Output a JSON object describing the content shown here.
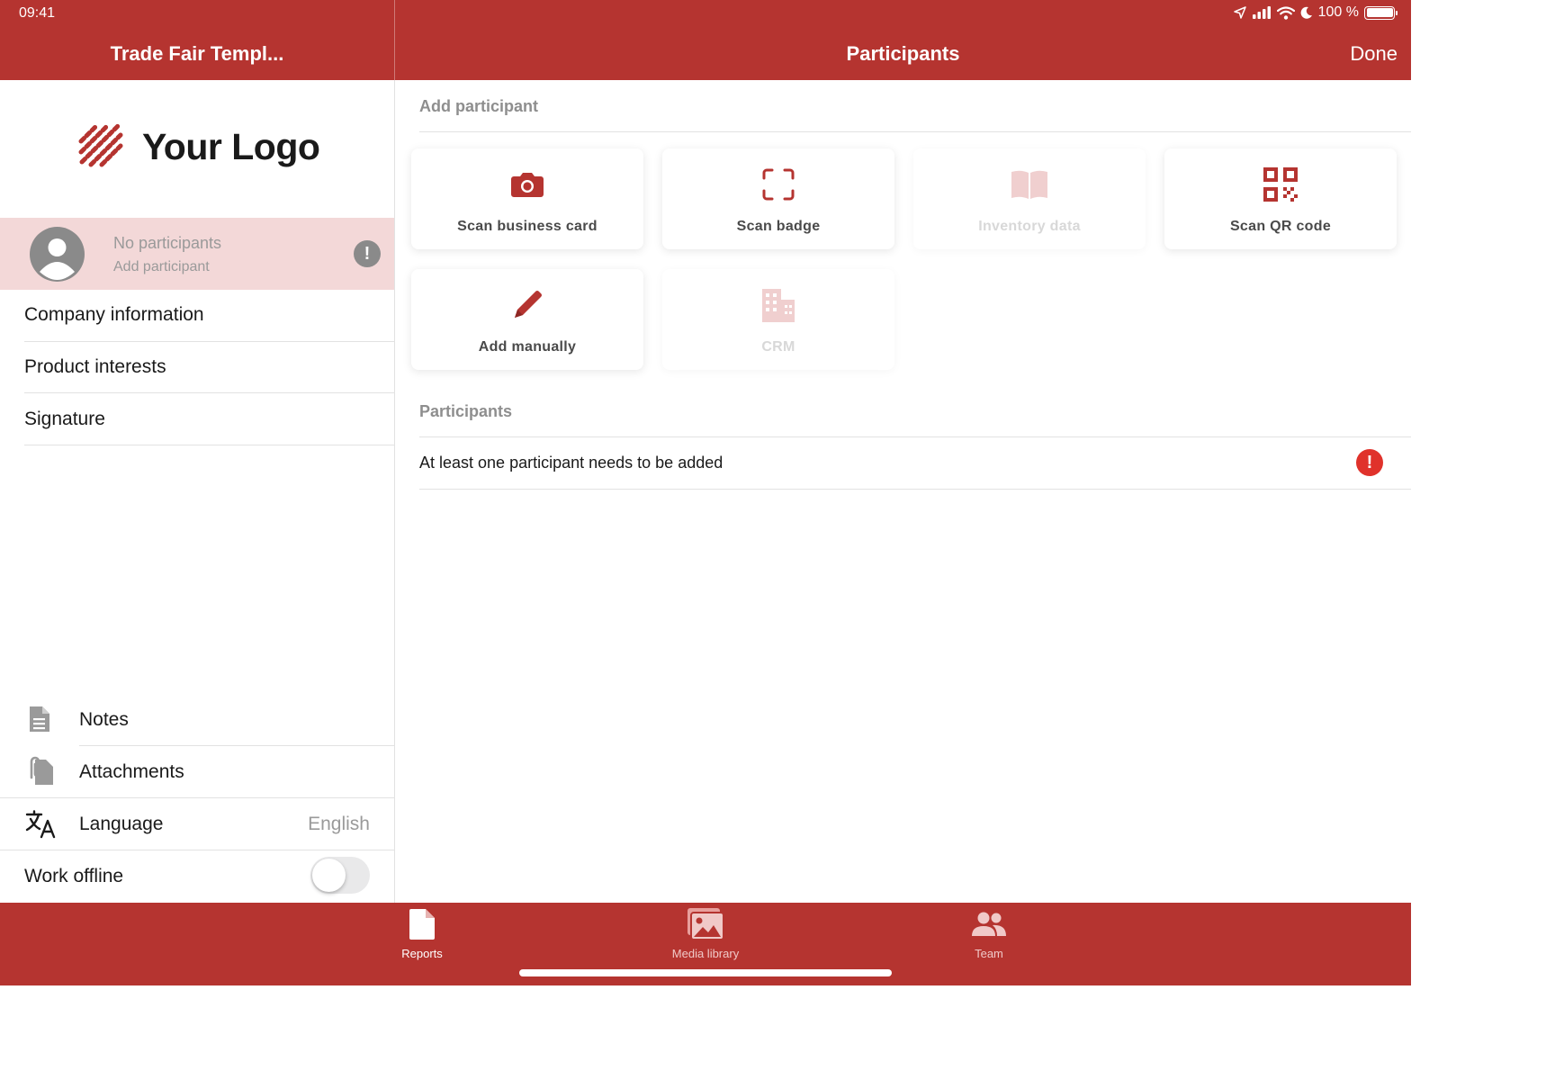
{
  "status_bar": {
    "time": "09:41",
    "battery": "100 %"
  },
  "header": {
    "left_title": "Trade Fair Templ...",
    "title": "Participants",
    "done_label": "Done"
  },
  "sidebar": {
    "logo_text": "Your Logo",
    "participant": {
      "title": "No participants",
      "subtitle": "Add participant",
      "warning_glyph": "!"
    },
    "items": [
      {
        "label": "Company information"
      },
      {
        "label": "Product interests"
      },
      {
        "label": "Signature"
      }
    ],
    "bottom_items": [
      {
        "label": "Notes",
        "icon": "document-icon"
      },
      {
        "label": "Attachments",
        "icon": "paperclip-icon"
      },
      {
        "label": "Language",
        "icon": "translate-icon",
        "value": "English"
      },
      {
        "label": "Work offline",
        "toggle": false
      }
    ]
  },
  "main": {
    "add_section_title": "Add participant",
    "cards": [
      {
        "label": "Scan business card",
        "icon": "camera-icon",
        "enabled": true
      },
      {
        "label": "Scan badge",
        "icon": "scan-frame-icon",
        "enabled": true
      },
      {
        "label": "Inventory data",
        "icon": "book-icon",
        "enabled": false
      },
      {
        "label": "Scan QR code",
        "icon": "qr-code-icon",
        "enabled": true
      },
      {
        "label": "Add manually",
        "icon": "pencil-icon",
        "enabled": true
      },
      {
        "label": "CRM",
        "icon": "building-icon",
        "enabled": false
      }
    ],
    "participants_section_title": "Participants",
    "warning_text": "At least one participant needs to be added",
    "warning_glyph": "!"
  },
  "tabbar": {
    "tabs": [
      {
        "label": "Reports",
        "icon": "report-icon",
        "active": true
      },
      {
        "label": "Media library",
        "icon": "media-icon",
        "active": false
      },
      {
        "label": "Team",
        "icon": "team-icon",
        "active": false
      }
    ]
  },
  "colors": {
    "brand": "#b53430",
    "highlight": "#f3d8d8",
    "error": "#e0322b",
    "muted": "#9a9a9a"
  }
}
